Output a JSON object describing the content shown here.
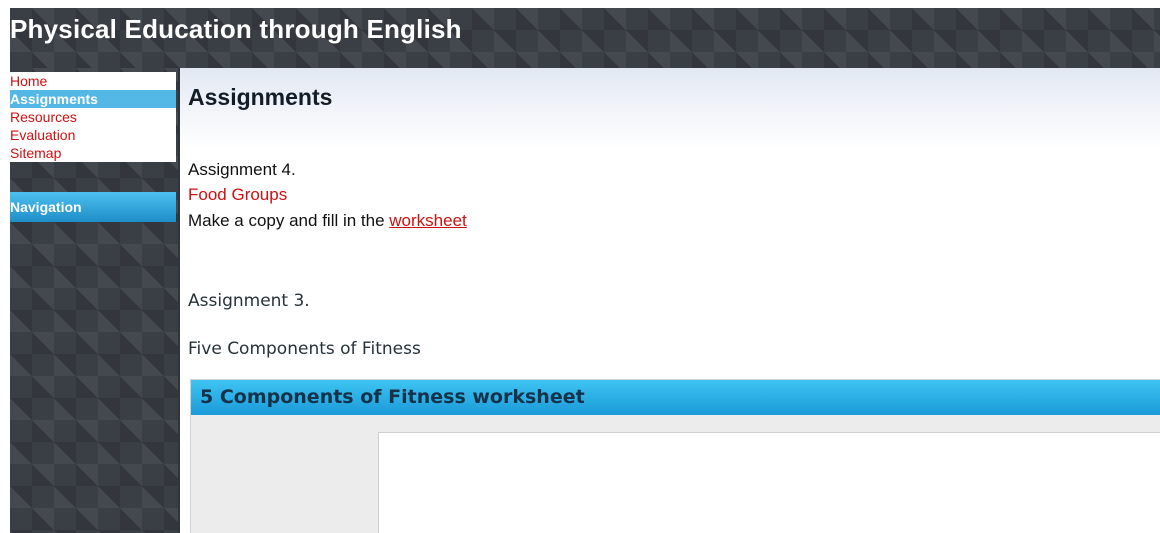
{
  "site": {
    "title": "Physical Education through English"
  },
  "sidebar": {
    "items": [
      {
        "label": "Home",
        "active": false
      },
      {
        "label": "Assignments",
        "active": true
      },
      {
        "label": "Resources",
        "active": false
      },
      {
        "label": "Evaluation",
        "active": false
      },
      {
        "label": "Sitemap",
        "active": false
      }
    ],
    "navigation_label": "Navigation"
  },
  "main": {
    "page_title": "Assignments",
    "assignment4": {
      "heading": "Assignment 4.",
      "topic": "Food Groups",
      "instruction_prefix": "Make a copy and fill in the ",
      "link_text": "worksheet"
    },
    "assignment3": {
      "heading": "Assignment 3.",
      "topic": "Five Components of Fitness"
    },
    "embed": {
      "title": "5 Components of Fitness worksheet"
    }
  },
  "colors": {
    "link": "#cc1111",
    "active_nav": "#53b8e6",
    "accent_blue": "#1f8ec8",
    "header_bg": "#3a3f46"
  }
}
